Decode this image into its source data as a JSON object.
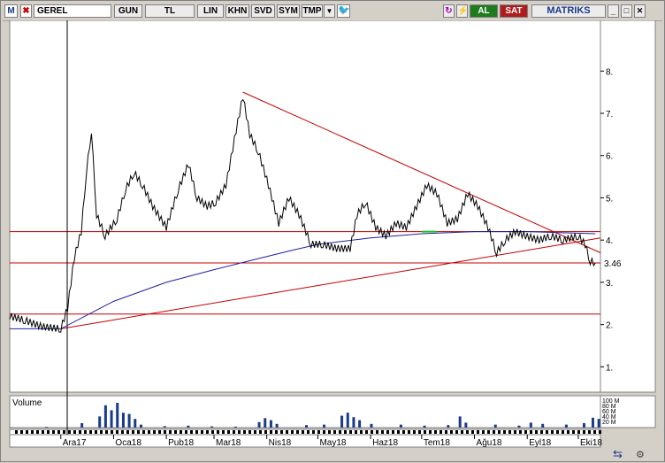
{
  "toolbar": {
    "logo": "M",
    "symbol": "GEREL",
    "period": "GUN",
    "currency": "TL",
    "scale": "LIN",
    "buttons": [
      "KHN",
      "SVD",
      "SYM",
      "TMP"
    ],
    "buy": "AL",
    "sell": "SAT",
    "brand": "MATRIKS",
    "colors": {
      "buy": "#1e7a1e",
      "sell": "#b01c1c",
      "price": "#000000",
      "ma": "#2020a0",
      "trendline": "#c00000"
    }
  },
  "chart_data": {
    "type": "line",
    "x": [
      "Ara17",
      "Oca18",
      "Şub18",
      "Mar18",
      "Nis18",
      "May18",
      "Haz18",
      "Tem18",
      "Ağu18",
      "Eyl18",
      "Eki18"
    ],
    "tick_labels": [
      "Ara17",
      "Oca18",
      "Pub18",
      "Mar18",
      "Nis18",
      "May18",
      "Haz18",
      "Tem18",
      "Ağu18",
      "Eyl18",
      "Eki18"
    ],
    "yticks": [
      1,
      2,
      3,
      4,
      5,
      6,
      7,
      8
    ],
    "ylim": [
      0.4,
      9.2
    ],
    "last_price_label": "3.46",
    "price_series": [
      [
        "2017-11-01",
        2.2
      ],
      [
        "2017-11-10",
        2.1
      ],
      [
        "2017-11-20",
        1.95
      ],
      [
        "2017-12-01",
        1.9
      ],
      [
        "2017-12-05",
        2.4
      ],
      [
        "2017-12-09",
        3.6
      ],
      [
        "2017-12-13",
        4.2
      ],
      [
        "2017-12-16",
        5.6
      ],
      [
        "2017-12-19",
        6.6
      ],
      [
        "2017-12-22",
        4.6
      ],
      [
        "2017-12-27",
        4.1
      ],
      [
        "2018-01-03",
        4.5
      ],
      [
        "2018-01-08",
        5.2
      ],
      [
        "2018-01-13",
        5.6
      ],
      [
        "2018-01-18",
        5.3
      ],
      [
        "2018-01-24",
        4.8
      ],
      [
        "2018-02-01",
        4.3
      ],
      [
        "2018-02-08",
        5.2
      ],
      [
        "2018-02-14",
        5.8
      ],
      [
        "2018-02-19",
        5.0
      ],
      [
        "2018-02-25",
        4.8
      ],
      [
        "2018-03-02",
        4.9
      ],
      [
        "2018-03-08",
        5.3
      ],
      [
        "2018-03-14",
        6.6
      ],
      [
        "2018-03-18",
        7.4
      ],
      [
        "2018-03-22",
        6.5
      ],
      [
        "2018-03-27",
        6.1
      ],
      [
        "2018-04-02",
        5.3
      ],
      [
        "2018-04-08",
        4.4
      ],
      [
        "2018-04-14",
        5.0
      ],
      [
        "2018-04-20",
        4.6
      ],
      [
        "2018-04-27",
        3.9
      ],
      [
        "2018-05-04",
        3.9
      ],
      [
        "2018-05-12",
        3.8
      ],
      [
        "2018-05-20",
        3.8
      ],
      [
        "2018-05-24",
        4.6
      ],
      [
        "2018-05-29",
        4.9
      ],
      [
        "2018-06-04",
        4.3
      ],
      [
        "2018-06-10",
        4.1
      ],
      [
        "2018-06-16",
        4.4
      ],
      [
        "2018-06-22",
        4.3
      ],
      [
        "2018-06-28",
        4.8
      ],
      [
        "2018-07-04",
        5.3
      ],
      [
        "2018-07-10",
        5.1
      ],
      [
        "2018-07-16",
        4.4
      ],
      [
        "2018-07-22",
        4.5
      ],
      [
        "2018-07-28",
        5.1
      ],
      [
        "2018-08-03",
        4.8
      ],
      [
        "2018-08-09",
        4.3
      ],
      [
        "2018-08-14",
        3.7
      ],
      [
        "2018-08-19",
        4.0
      ],
      [
        "2018-08-25",
        4.2
      ],
      [
        "2018-08-31",
        4.1
      ],
      [
        "2018-09-08",
        4.0
      ],
      [
        "2018-09-15",
        4.1
      ],
      [
        "2018-09-22",
        4.0
      ],
      [
        "2018-10-01",
        4.1
      ],
      [
        "2018-10-05",
        3.9
      ],
      [
        "2018-10-08",
        3.5
      ],
      [
        "2018-10-11",
        3.46
      ]
    ],
    "ma_series": [
      [
        "2017-11-01",
        1.9
      ],
      [
        "2017-12-01",
        1.9
      ],
      [
        "2018-01-01",
        2.55
      ],
      [
        "2018-02-01",
        3.0
      ],
      [
        "2018-03-01",
        3.3
      ],
      [
        "2018-03-26",
        3.55
      ],
      [
        "2018-04-15",
        3.75
      ],
      [
        "2018-05-01",
        3.9
      ],
      [
        "2018-06-01",
        4.05
      ],
      [
        "2018-07-01",
        4.15
      ],
      [
        "2018-08-01",
        4.2
      ],
      [
        "2018-09-01",
        4.2
      ],
      [
        "2018-10-11",
        4.15
      ]
    ],
    "volume_axis_labels": [
      "100 M",
      "80 M",
      "60 M",
      "40 M",
      "20 M"
    ],
    "volume_label": "Volume",
    "volume_series": [
      [
        0,
        1
      ],
      [
        0.06,
        3
      ],
      [
        0.12,
        18
      ],
      [
        0.15,
        45
      ],
      [
        0.16,
        90
      ],
      [
        0.17,
        70
      ],
      [
        0.18,
        100
      ],
      [
        0.19,
        60
      ],
      [
        0.2,
        55
      ],
      [
        0.21,
        35
      ],
      [
        0.22,
        12
      ],
      [
        0.26,
        6
      ],
      [
        0.3,
        8
      ],
      [
        0.34,
        5
      ],
      [
        0.38,
        4
      ],
      [
        0.42,
        22
      ],
      [
        0.43,
        38
      ],
      [
        0.44,
        30
      ],
      [
        0.45,
        15
      ],
      [
        0.5,
        10
      ],
      [
        0.53,
        12
      ],
      [
        0.56,
        48
      ],
      [
        0.57,
        60
      ],
      [
        0.58,
        42
      ],
      [
        0.59,
        30
      ],
      [
        0.61,
        15
      ],
      [
        0.66,
        12
      ],
      [
        0.7,
        8
      ],
      [
        0.74,
        10
      ],
      [
        0.76,
        45
      ],
      [
        0.77,
        20
      ],
      [
        0.82,
        12
      ],
      [
        0.86,
        8
      ],
      [
        0.88,
        20
      ],
      [
        0.9,
        15
      ],
      [
        0.94,
        12
      ],
      [
        0.97,
        18
      ],
      [
        0.985,
        40
      ],
      [
        0.995,
        35
      ]
    ]
  }
}
